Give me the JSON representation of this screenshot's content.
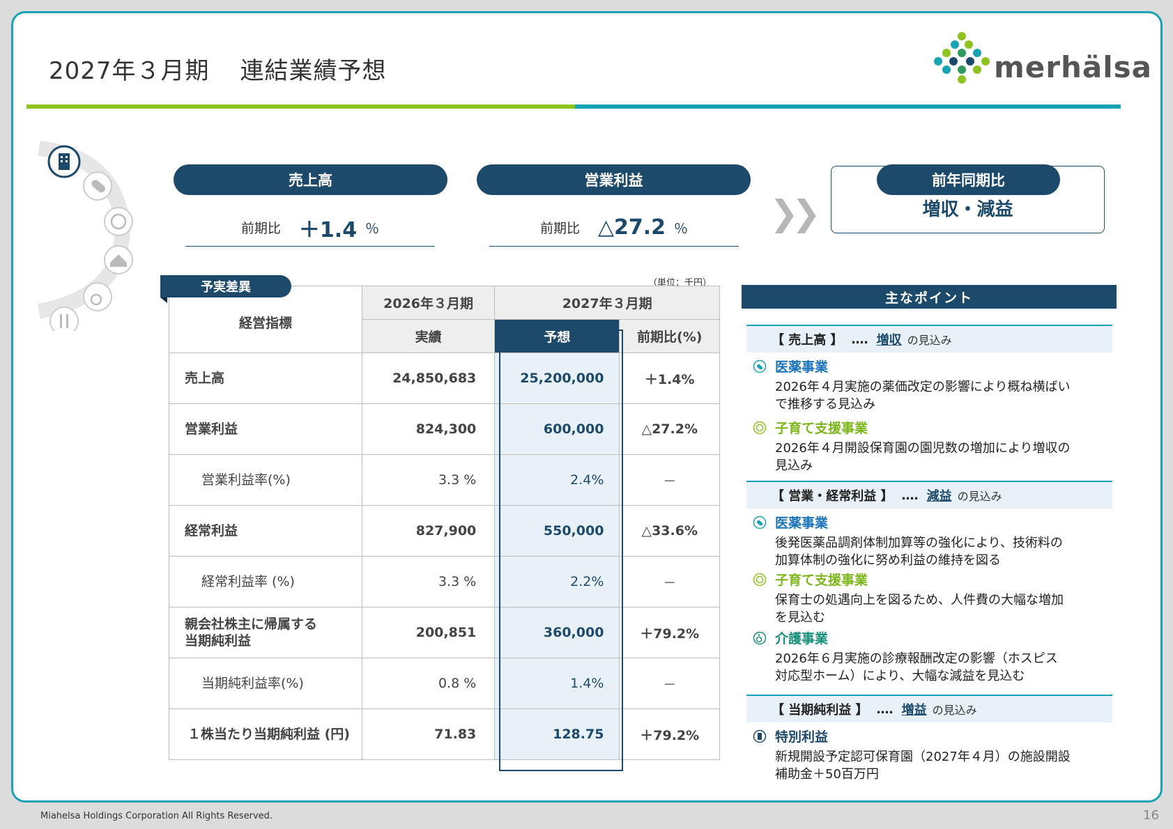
{
  "title": {
    "main": "2027年３月期",
    "sub": "連結業績予想"
  },
  "logo": {
    "text": "merhälsa"
  },
  "kpis": [
    {
      "label": "売上高",
      "compare_label": "前期比",
      "value": "＋1.4",
      "unit": "％"
    },
    {
      "label": "営業利益",
      "compare_label": "前期比",
      "value": "△27.2",
      "unit": "％"
    }
  ],
  "yoy": {
    "label": "前年同期比",
    "value": "増収・減益"
  },
  "table": {
    "tag": "予実差異",
    "unit": "（単位：千円）",
    "header_metric": "経営指標",
    "header_fy2026": "2026年３月期",
    "header_fy2027": "2027年３月期",
    "sub_actual": "実績",
    "sub_forecast": "予想",
    "sub_ratio": "前期比(%)",
    "rows": [
      {
        "name": "売上高",
        "actual": "24,850,683",
        "forecast": "25,200,000",
        "ratio": "＋1.4%"
      },
      {
        "name": "営業利益",
        "actual": "824,300",
        "forecast": "600,000",
        "ratio": "△27.2%"
      },
      {
        "name": "営業利益率(%)",
        "actual": "3.3 %",
        "forecast": "2.4%",
        "ratio": "－"
      },
      {
        "name": "経常利益",
        "actual": "827,900",
        "forecast": "550,000",
        "ratio": "△33.6%"
      },
      {
        "name": "経常利益率 (%)",
        "actual": "3.3 %",
        "forecast": "2.2%",
        "ratio": "－"
      },
      {
        "name1": "親会社株主に帰属する",
        "name2": "当期純利益",
        "actual": "200,851",
        "forecast": "360,000",
        "ratio": "＋79.2%"
      },
      {
        "name": "当期純利益率(%)",
        "actual": "0.8 %",
        "forecast": "1.4%",
        "ratio": "－"
      },
      {
        "name": "１株当たり当期純利益 (円)",
        "actual": "71.83",
        "forecast": "128.75",
        "ratio": "＋79.2%"
      }
    ]
  },
  "points": {
    "title": "主なポイント",
    "sections": [
      {
        "key": "【 売上高 】",
        "dots": "‥‥",
        "highlight": "増収",
        "tail": "の見込み"
      },
      {
        "key": "【 営業・経常利益 】",
        "dots": "‥‥",
        "highlight": "減益",
        "tail": "の見込み"
      },
      {
        "key": "【 当期純利益 】",
        "dots": "‥‥",
        "highlight": "増益",
        "tail": "の見込み"
      }
    ],
    "items": [
      {
        "head": "医薬事業",
        "l1": "2026年４月実施の薬価改定の影響により概ね横ばい",
        "l2": "で推移する見込み"
      },
      {
        "head": "子育て支援事業",
        "l1": "2026年４月開設保育園の園児数の増加により増収の",
        "l2": "見込み"
      },
      {
        "head": "医薬事業",
        "l1": "後発医薬品調剤体制加算等の強化により、技術料の",
        "l2": "加算体制の強化に努め利益の維持を図る"
      },
      {
        "head": "子育て支援事業",
        "l1": "保育士の処遇向上を図るため、人件費の大幅な増加",
        "l2": "を見込む"
      },
      {
        "head": "介護事業",
        "l1": "2026年６月実施の診療報酬改定の影響（ホスピス",
        "l2": "対応型ホーム）により、大幅な減益を見込む"
      },
      {
        "head": "特別利益",
        "l1": "新規開設予定認可保育園（2027年４月）の施設開設",
        "l2": "補助金＋50百万円"
      }
    ]
  },
  "footer": {
    "copyright": "Miahelsa Holdings Corporation All Rights Reserved.",
    "page": "16"
  },
  "colors": {
    "navy": "#1d4a6b",
    "teal": "#17a3b4",
    "green": "#8fc31f"
  }
}
